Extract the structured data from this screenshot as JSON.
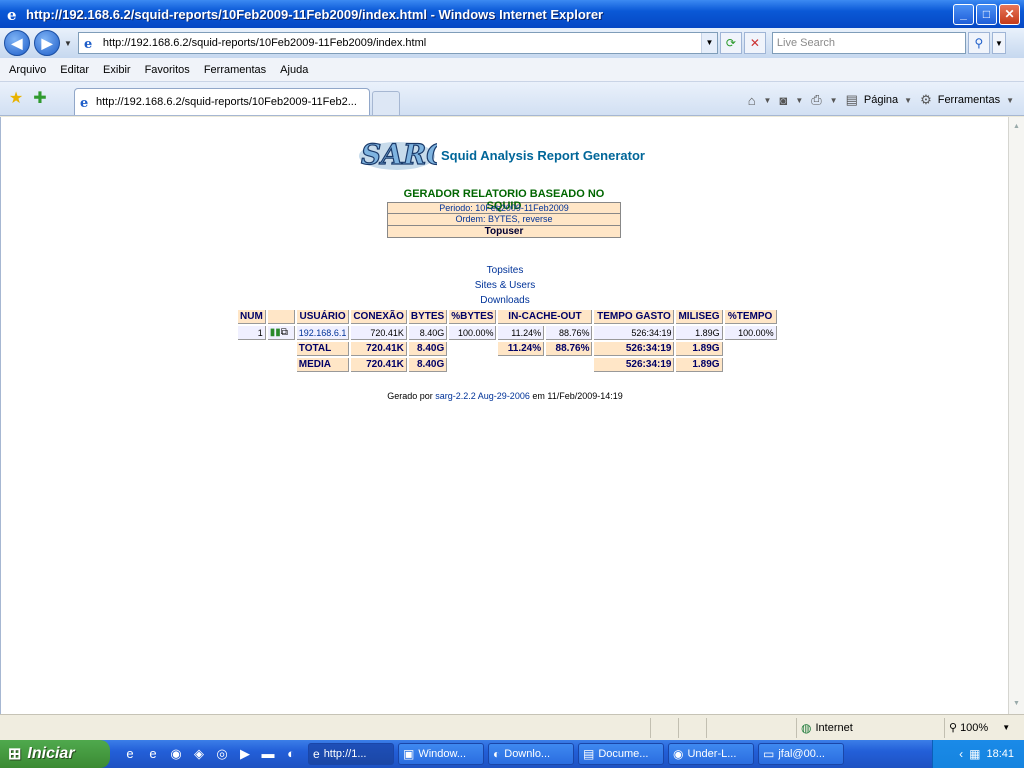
{
  "window": {
    "title": "http://192.168.6.2/squid-reports/10Feb2009-11Feb2009/index.html - Windows Internet Explorer",
    "min": "_",
    "max": "□",
    "close": "✕"
  },
  "addressbar": {
    "url": "http://192.168.6.2/squid-reports/10Feb2009-11Feb2009/index.html",
    "search_placeholder": "Live Search"
  },
  "menu": [
    "Arquivo",
    "Editar",
    "Exibir",
    "Favoritos",
    "Ferramentas",
    "Ajuda"
  ],
  "tab": {
    "label": "http://192.168.6.2/squid-reports/10Feb2009-11Feb2..."
  },
  "toolbar": {
    "pagina_label": "Página",
    "ferramentas_label": "Ferramentas"
  },
  "report": {
    "logo_text": "SARG",
    "subtitle": "Squid Analysis Report Generator",
    "heading": "GERADOR RELATORIO BASEADO NO SQUID",
    "period": "Periodo: 10Feb2009-11Feb2009",
    "order": "Ordem: BYTES, reverse",
    "topuser": "Topuser",
    "links": [
      "Topsites",
      "Sites & Users",
      "Downloads"
    ],
    "columns": [
      "NUM",
      "",
      "USUÁRIO",
      "CONEXÃO",
      "BYTES",
      "%BYTES",
      "IN-CACHE-OUT",
      "",
      "TEMPO GASTO",
      "MILISEG",
      "%TEMPO"
    ],
    "rows": [
      {
        "num": "1",
        "user": "192.168.6.1",
        "conexao": "720.41K",
        "bytes": "8.40G",
        "pct_bytes": "100.00%",
        "in_cache": "11.24%",
        "out_cache": "88.76%",
        "tempo": "526:34:19",
        "miliseg": "1.89G",
        "pct_tempo": "100.00%"
      }
    ],
    "total": {
      "label": "TOTAL",
      "conexao": "720.41K",
      "bytes": "8.40G",
      "in_cache": "11.24%",
      "out_cache": "88.76%",
      "tempo": "526:34:19",
      "miliseg": "1.89G"
    },
    "media": {
      "label": "MEDIA",
      "conexao": "720.41K",
      "bytes": "8.40G",
      "tempo": "526:34:19",
      "miliseg": "1.89G"
    },
    "footer": {
      "prefix": "Gerado por",
      "link": "sarg-2.2.2 Aug-29-2006",
      "suffix": "em 11/Feb/2009-14:19"
    }
  },
  "statusbar": {
    "zone": "Internet",
    "zoom": "100%"
  },
  "taskbar": {
    "start": "Iniciar",
    "items": [
      "http://1...",
      "Window...",
      "Downlo...",
      "Docume...",
      "Under-L...",
      "jfal@00..."
    ],
    "clock": "18:41"
  }
}
